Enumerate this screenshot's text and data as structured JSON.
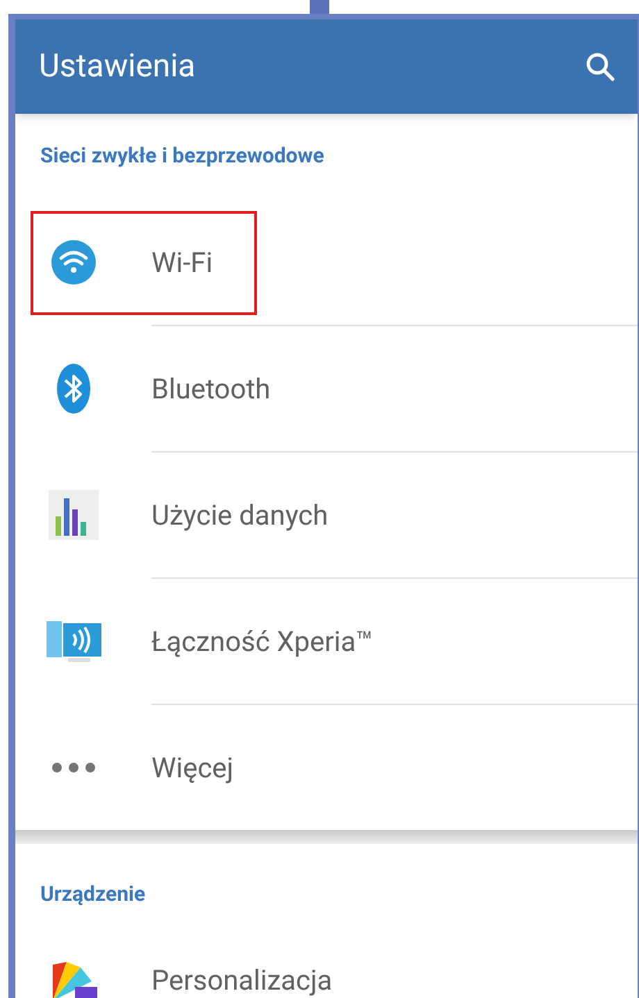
{
  "app_bar": {
    "title": "Ustawienia"
  },
  "sections": [
    {
      "title": "Sieci zwykłe i bezprzewodowe",
      "items": [
        {
          "label": "Wi-Fi",
          "kind": "wifi",
          "highlighted": true
        },
        {
          "label": "Bluetooth",
          "kind": "bluetooth",
          "highlighted": false
        },
        {
          "label": "Użycie danych",
          "kind": "data",
          "highlighted": false
        },
        {
          "label": "Łączność Xperia™",
          "kind": "xperia",
          "highlighted": false
        },
        {
          "label": "Więcej",
          "kind": "more",
          "highlighted": false
        }
      ]
    },
    {
      "title": "Urządzenie",
      "items": [
        {
          "label": "Personalizacja",
          "kind": "personalize",
          "highlighted": false
        }
      ]
    }
  ]
}
